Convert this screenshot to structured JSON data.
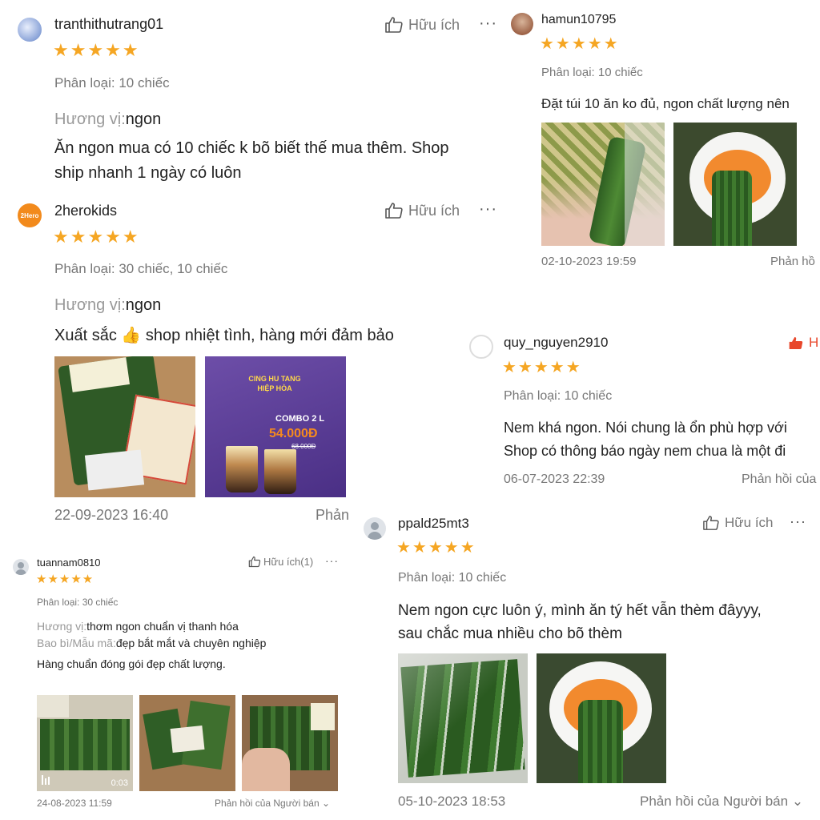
{
  "icons": {
    "like": "thumbs-up-icon",
    "more": "more-horizontal-icon",
    "chevron": "chevron-down-icon",
    "bars": "bars-icon"
  },
  "colors": {
    "star": "#f5a623",
    "liked": "#e8472b",
    "text": "#222222",
    "muted": "#777777"
  },
  "reviews": [
    {
      "username": "tranthithutrang01",
      "stars": "★★★★★",
      "helpful": "Hữu ích",
      "variation": "Phân loại: 10 chiếc",
      "flavor_label": "Hương vị:",
      "flavor_value": "ngon",
      "text_line1": "Ăn ngon mua có 10 chiếc k bõ biết thế mua thêm. Shop",
      "text_line2": "ship nhanh 1 ngày có luôn"
    },
    {
      "username": "hamun10795",
      "stars": "★★★★★",
      "variation": "Phân loại: 10 chiếc",
      "text": "Đặt túi 10 ăn ko đủ, ngon chất lượng nên",
      "timestamp": "02-10-2023 19:59",
      "reply": "Phản hồ"
    },
    {
      "username": "2herokids",
      "avatar_text": "2Hero",
      "stars": "★★★★★",
      "helpful": "Hữu ích",
      "variation": "Phân loại: 30 chiếc, 10 chiếc",
      "flavor_label": "Hương vị:",
      "flavor_value": "ngon",
      "text": "Xuất sắc 👍 shop nhiệt tình, hàng mới đảm bảo",
      "timestamp": "22-09-2023 16:40",
      "reply": "Phản",
      "photo2_text": {
        "brand": "CING HU TANG HIỆP HÒA",
        "combo": "COMBO 2 L",
        "price": "54.000Đ",
        "old_price": "68.000Đ"
      }
    },
    {
      "username": "quy_nguyen2910",
      "stars": "★★★★★",
      "helpful": "H",
      "variation": "Phân loại: 10 chiếc",
      "text_line1": "Nem khá ngon. Nói chung là ổn phù hợp với",
      "text_line2": "Shop có thông báo ngày nem chua là một đi",
      "timestamp": "06-07-2023 22:39",
      "reply": "Phản hồi của"
    },
    {
      "username": "tuannam0810",
      "stars": "★★★★★",
      "helpful": "Hữu ích(1)",
      "variation": "Phân loại: 30 chiếc",
      "flavor_label": "Hương vị:",
      "flavor_value": "thơm ngon chuẩn vị thanh hóa",
      "pack_label": "Bao bì/Mẫu mã:",
      "pack_value": "đẹp bắt mắt và chuyên nghiệp",
      "text": "Hàng chuẩn đóng gói đẹp chất lượng.",
      "video_duration": "0:03",
      "timestamp": "24-08-2023 11:59",
      "reply": "Phản hồi của Người bán"
    },
    {
      "username": "ppald25mt3",
      "stars": "★★★★★",
      "helpful": "Hữu ích",
      "variation": "Phân loại: 10 chiếc",
      "text_line1": "Nem ngon cực luôn ý, mình ăn tý hết vẫn thèm đâyyy,",
      "text_line2": "sau chắc mua nhiều cho bõ thèm",
      "timestamp": "05-10-2023 18:53",
      "reply": "Phản hồi của Người bán"
    }
  ]
}
